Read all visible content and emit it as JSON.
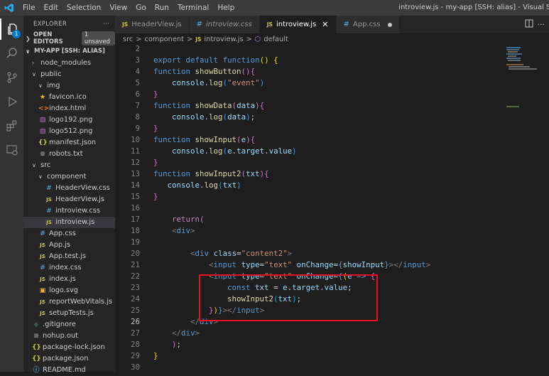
{
  "titlebar": {
    "menu": [
      "File",
      "Edit",
      "Selection",
      "View",
      "Go",
      "Run",
      "Terminal",
      "Help"
    ],
    "window_title": "introview.js - my-app [SSH: alias] - Visual Studio"
  },
  "activity": {
    "badge": "1"
  },
  "sidebar": {
    "header": "EXPLORER",
    "more": "···",
    "open_editors": "OPEN EDITORS",
    "unsaved": "1 unsaved",
    "root": "MY-APP [SSH: ALIAS]",
    "items": [
      {
        "label": "node_modules",
        "icon": "chevron-right",
        "indent": 0
      },
      {
        "label": "public",
        "icon": "chevron-down",
        "indent": 0
      },
      {
        "label": "img",
        "icon": "chevron-down",
        "indent": 1
      },
      {
        "label": "favicon.ico",
        "icon": "star",
        "indent": 1
      },
      {
        "label": "index.html",
        "icon": "html",
        "indent": 1
      },
      {
        "label": "logo192.png",
        "icon": "image",
        "indent": 1
      },
      {
        "label": "logo512.png",
        "icon": "image",
        "indent": 1
      },
      {
        "label": "manifest.json",
        "icon": "json",
        "indent": 1
      },
      {
        "label": "robots.txt",
        "icon": "text",
        "indent": 1
      },
      {
        "label": "src",
        "icon": "chevron-down",
        "indent": 0
      },
      {
        "label": "component",
        "icon": "chevron-down",
        "indent": 1
      },
      {
        "label": "HeaderView.css",
        "icon": "css",
        "indent": 2
      },
      {
        "label": "HeaderView.js",
        "icon": "js",
        "indent": 2
      },
      {
        "label": "introview.css",
        "icon": "css",
        "indent": 2
      },
      {
        "label": "introview.js",
        "icon": "js",
        "indent": 2,
        "selected": true
      },
      {
        "label": "App.css",
        "icon": "css",
        "indent": 1
      },
      {
        "label": "App.js",
        "icon": "js",
        "indent": 1
      },
      {
        "label": "App.test.js",
        "icon": "js",
        "indent": 1
      },
      {
        "label": "index.css",
        "icon": "css",
        "indent": 1
      },
      {
        "label": "index.js",
        "icon": "js",
        "indent": 1
      },
      {
        "label": "logo.svg",
        "icon": "svg",
        "indent": 1
      },
      {
        "label": "reportWebVitals.js",
        "icon": "js",
        "indent": 1
      },
      {
        "label": "setupTests.js",
        "icon": "js",
        "indent": 1
      },
      {
        "label": ".gitignore",
        "icon": "git",
        "indent": 0
      },
      {
        "label": "nohup.out",
        "icon": "text",
        "indent": 0
      },
      {
        "label": "package-lock.json",
        "icon": "json",
        "indent": 0
      },
      {
        "label": "package.json",
        "icon": "json",
        "indent": 0
      },
      {
        "label": "README.md",
        "icon": "info",
        "indent": 0
      }
    ]
  },
  "tabs": [
    {
      "label": "HeaderView.js",
      "icon": "JS",
      "italic": false,
      "active": false
    },
    {
      "label": "introview.css",
      "icon": "#",
      "italic": true,
      "active": false
    },
    {
      "label": "introview.js",
      "icon": "JS",
      "italic": false,
      "active": true
    },
    {
      "label": "App.css",
      "icon": "#",
      "italic": false,
      "active": false,
      "dirty": true
    }
  ],
  "breadcrumb": [
    "src",
    ">",
    "component",
    ">",
    "JS",
    "introview.js",
    ">",
    "default"
  ],
  "editor": {
    "current_line": 26,
    "lines": [
      {
        "n": 2,
        "html": ""
      },
      {
        "n": 3,
        "html": "<span class='k'>export</span> <span class='k'>default</span> <span class='k'>function</span><span class='b1'>()</span> <span class='b1'>{</span>"
      },
      {
        "n": 4,
        "html": "<span class='k'>function</span> <span class='f'>showButton</span><span class='b2'>()</span><span class='b2'>{</span>"
      },
      {
        "n": 5,
        "html": "    <span class='v'>console</span>.<span class='f'>log</span><span class='b3'>(</span><span class='s'>\"event\"</span><span class='b3'>)</span>"
      },
      {
        "n": 6,
        "html": "<span class='b2'>}</span>"
      },
      {
        "n": 7,
        "html": "<span class='k'>function</span> <span class='f'>showData</span><span class='b2'>(</span><span class='v'>data</span><span class='b2'>)</span><span class='b2'>{</span>"
      },
      {
        "n": 8,
        "html": "    <span class='v'>console</span>.<span class='f'>log</span><span class='b3'>(</span><span class='v'>data</span><span class='b3'>)</span>;"
      },
      {
        "n": 9,
        "html": "<span class='b2'>}</span>"
      },
      {
        "n": 10,
        "html": "<span class='k'>function</span> <span class='f'>showInput</span><span class='b2'>(</span><span class='v'>e</span><span class='b2'>)</span><span class='b2'>{</span>"
      },
      {
        "n": 11,
        "html": "    <span class='v'>console</span>.<span class='f'>log</span><span class='b3'>(</span><span class='v'>e</span>.<span class='v'>target</span>.<span class='v'>value</span><span class='b3'>)</span>"
      },
      {
        "n": 12,
        "html": "<span class='b2'>}</span>"
      },
      {
        "n": 13,
        "html": "<span class='k'>function</span> <span class='f'>showInput2</span><span class='b2'>(</span><span class='v'>txt</span><span class='b2'>)</span><span class='b2'>{</span>"
      },
      {
        "n": 14,
        "html": "   <span class='v'>console</span>.<span class='f'>log</span><span class='b3'>(</span><span class='v'>txt</span><span class='b3'>)</span>"
      },
      {
        "n": 15,
        "html": "<span class='b2'>}</span>"
      },
      {
        "n": 16,
        "html": ""
      },
      {
        "n": 17,
        "html": "    <span class='c'>return</span><span class='b2'>(</span>"
      },
      {
        "n": 18,
        "html": "    <span class='t'>&lt;</span><span class='k'>div</span><span class='t'>&gt;</span>"
      },
      {
        "n": 19,
        "html": ""
      },
      {
        "n": 20,
        "html": "        <span class='t'>&lt;</span><span class='k'>div</span> <span class='v'>class</span><span class='p'>=</span><span class='s'>\"content2\"</span><span class='t'>&gt;</span>"
      },
      {
        "n": 21,
        "html": "            <span class='t'>&lt;</span><span class='k'>input</span> <span class='v'>type</span><span class='p'>=</span><span class='s'>\"text\"</span> <span class='v'>onChange</span><span class='p'>=</span><span class='k'>{</span><span class='v'>showInput</span><span class='k'>}</span><span class='t'>&gt;&lt;/</span><span class='k'>input</span><span class='t'>&gt;</span>"
      },
      {
        "n": 22,
        "html": "            <span class='t'>&lt;</span><span class='k'>input</span> <span class='v'>type</span><span class='p'>=</span><span class='s'>\"text\"</span> <span class='v'>onChange</span><span class='p'>=</span><span class='k'>{</span><span class='b1'>(</span><span class='v'>e</span> <span class='k'>=&gt;</span> <span class='b2'>{</span>"
      },
      {
        "n": 23,
        "html": "                <span class='k'>const</span> <span class='v'>txt</span> = <span class='v'>e</span>.<span class='v'>target</span>.<span class='v'>value</span>;"
      },
      {
        "n": 24,
        "html": "                <span class='f'>showInput2</span><span class='b3'>(</span><span class='v'>txt</span><span class='b3'>)</span>;"
      },
      {
        "n": 25,
        "html": "            <span class='b2'>}</span><span class='b1'>)</span><span class='k'>}</span><span class='t'>&gt;&lt;/</span><span class='k'>input</span><span class='t'>&gt;</span>"
      },
      {
        "n": 26,
        "html": "        <span class='t'>&lt;/</span><span class='k'>div</span><span class='t'>&gt;</span>"
      },
      {
        "n": 27,
        "html": "    <span class='t'>&lt;/</span><span class='k'>div</span><span class='t'>&gt;</span>"
      },
      {
        "n": 28,
        "html": "    <span class='b2'>)</span>;"
      },
      {
        "n": 29,
        "html": "<span class='b1'>}</span>"
      },
      {
        "n": 30,
        "html": ""
      }
    ]
  },
  "colors": {
    "accent": "#007acc",
    "highlight_box": "#e81123"
  }
}
